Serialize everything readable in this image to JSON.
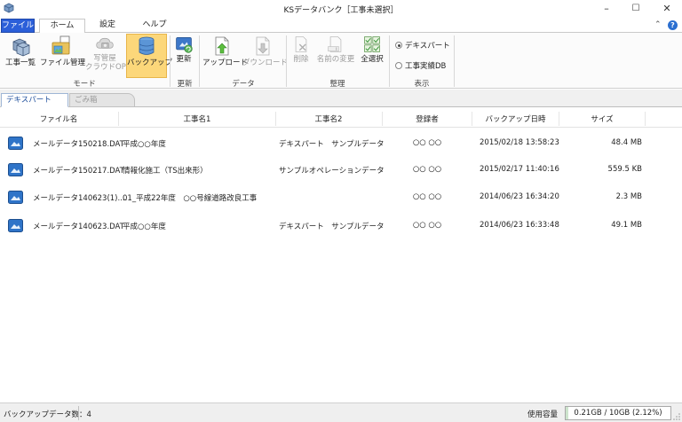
{
  "window": {
    "title": "KSデータバンク［工事未選択］",
    "minimize": "–",
    "maximize": "☐",
    "close": "✕"
  },
  "menu": {
    "tabs": [
      {
        "label": "ファイル"
      },
      {
        "label": "ホーム"
      },
      {
        "label": "設定"
      },
      {
        "label": "ヘルプ"
      }
    ],
    "collapse_glyph": "⌃",
    "help_glyph": "?"
  },
  "ribbon": {
    "mode": {
      "group_label": "モード",
      "buttons": [
        {
          "label": "工事一覧",
          "icon": "cube-stack-icon"
        },
        {
          "label": "ファイル管理",
          "icon": "folder-files-icon"
        },
        {
          "label": "写管屋",
          "label2": "クラウドOP",
          "icon": "cloud-camera-icon",
          "disabled": true
        },
        {
          "label": "バックアップ",
          "icon": "database-icon",
          "selected": true
        }
      ]
    },
    "update": {
      "group_label": "更新",
      "buttons": [
        {
          "label": "更新",
          "icon": "refresh-icon"
        }
      ]
    },
    "data": {
      "group_label": "データ",
      "buttons": [
        {
          "label": "アップロード",
          "icon": "upload-icon"
        },
        {
          "label": "ダウンロード",
          "icon": "download-icon",
          "disabled": true
        }
      ]
    },
    "organize": {
      "group_label": "整理",
      "buttons": [
        {
          "label": "削除",
          "icon": "delete-file-icon",
          "disabled": true
        },
        {
          "label": "名前の変更",
          "icon": "rename-icon",
          "disabled": true
        },
        {
          "label": "全選択",
          "icon": "select-all-icon"
        }
      ]
    },
    "display": {
      "group_label": "表示",
      "options": [
        {
          "label": "デキスパート",
          "selected": true
        },
        {
          "label": "工事実績DB",
          "selected": false
        }
      ]
    }
  },
  "subtabs": [
    {
      "label": "デキスパート"
    },
    {
      "label": "ごみ箱"
    }
  ],
  "table": {
    "columns": [
      "ファイル名",
      "工事名1",
      "工事名2",
      "登録者",
      "バックアップ日時",
      "サイズ"
    ],
    "rows": [
      {
        "file": "メールデータ150218.DAT",
        "name1": "平成○○年度",
        "name2": "デキスパート　サンプルデータ",
        "user": "○○ ○○",
        "date": "2015/02/18 13:58:23",
        "size": "48.4 MB"
      },
      {
        "file": "メールデータ150217.DAT",
        "name1": "情報化施工（TS出来形）",
        "name2": "サンプルオペレーションデータ",
        "user": "○○ ○○",
        "date": "2015/02/17 11:40:16",
        "size": "559.5 KB"
      },
      {
        "file": "メールデータ140623(1)....",
        "name1": "01_平成22年度　○○号線道路改良工事",
        "name2": "",
        "user": "○○ ○○",
        "date": "2014/06/23 16:34:20",
        "size": "2.3 MB"
      },
      {
        "file": "メールデータ140623.DAT",
        "name1": "平成○○年度",
        "name2": "デキスパート　サンプルデータ",
        "user": "○○ ○○",
        "date": "2014/06/23 16:33:48",
        "size": "49.1 MB"
      }
    ]
  },
  "status": {
    "backup_count": "バックアップデータ数：4",
    "usage_label": "使用容量",
    "usage_value": "0.21GB / 10GB (2.12%)",
    "usage_fraction": 0.0212
  },
  "colors": {
    "file_tab": "#2b5fd9",
    "selected_button": "#fcd77a",
    "accent": "#1e4f9c"
  }
}
